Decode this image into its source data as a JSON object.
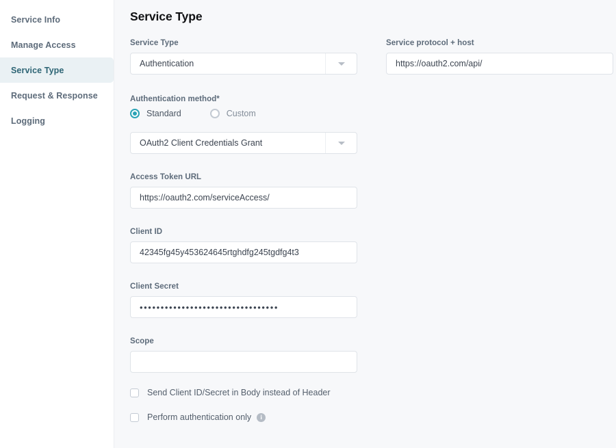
{
  "sidebar": {
    "items": [
      {
        "label": "Service Info",
        "active": false
      },
      {
        "label": "Manage Access",
        "active": false
      },
      {
        "label": "Service Type",
        "active": true
      },
      {
        "label": "Request & Response",
        "active": false
      },
      {
        "label": "Logging",
        "active": false
      }
    ]
  },
  "main": {
    "page_title": "Service Type",
    "service_type": {
      "label": "Service Type",
      "value": "Authentication",
      "arrow_icon": "chevron-down-icon"
    },
    "protocol_host": {
      "label": "Service protocol + host",
      "value": "https://oauth2.com/api/"
    },
    "auth_method": {
      "label": "Authentication method*",
      "options": [
        {
          "label": "Standard",
          "selected": true
        },
        {
          "label": "Custom",
          "selected": false
        }
      ],
      "grant": {
        "value": "OAuth2 Client Credentials Grant",
        "arrow_icon": "chevron-down-icon"
      }
    },
    "access_token_url": {
      "label": "Access Token URL",
      "value": "https://oauth2.com/serviceAccess/"
    },
    "client_id": {
      "label": "Client ID",
      "value": "42345fg45y453624645rtghdfg245tgdfg4t3"
    },
    "client_secret": {
      "label": "Client Secret",
      "value": "•••••••••••••••••••••••••••••••••"
    },
    "scope": {
      "label": "Scope",
      "value": ""
    },
    "checkboxes": [
      {
        "label": "Send Client ID/Secret in Body instead of Header",
        "checked": false,
        "info": false
      },
      {
        "label": "Perform authentication only",
        "checked": false,
        "info": true
      }
    ]
  },
  "colors": {
    "accent": "#2ba3b6",
    "active_nav_bg": "#eaf1f4",
    "active_nav_text": "#2e6575",
    "page_bg": "#f7f8fa",
    "border": "#dfe3e8"
  }
}
